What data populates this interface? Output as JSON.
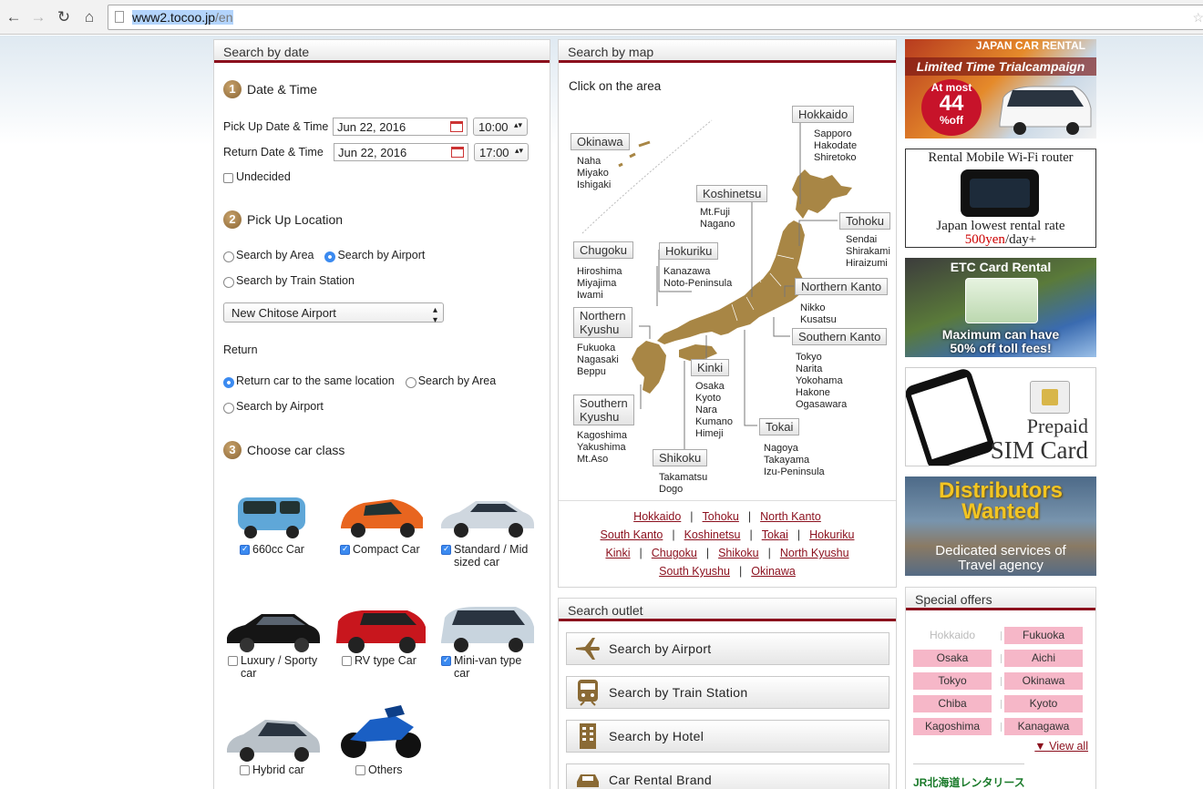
{
  "browser": {
    "url_host": "www2.tocoo.jp",
    "url_path": "/en"
  },
  "search_by_date": {
    "title": "Search by date",
    "step1": {
      "num": "1",
      "label": "Date & Time"
    },
    "pickup_label": "Pick Up Date & Time",
    "pickup_date": "Jun 22, 2016",
    "pickup_time": "10:00",
    "return_label": "Return Date & Time",
    "return_date": "Jun 22, 2016",
    "return_time": "17:00",
    "undecided_label": "Undecided",
    "step2": {
      "num": "2",
      "label": "Pick Up Location"
    },
    "search_area_label": "Search by Area",
    "search_airport_label": "Search by Airport",
    "search_train_label": "Search by Train Station",
    "airport_select": "New Chitose Airport",
    "return_heading": "Return",
    "return_same_label": "Return car to the same location",
    "return_area_label": "Search by Area",
    "return_airport_label": "Search by Airport",
    "step3": {
      "num": "3",
      "label": "Choose car class"
    },
    "car_classes": [
      {
        "label": "660cc Car",
        "checked": true
      },
      {
        "label": "Compact Car",
        "checked": true
      },
      {
        "label": "Standard / Mid sized car",
        "checked": true
      },
      {
        "label": "Luxury / Sporty car",
        "checked": false
      },
      {
        "label": "RV type Car",
        "checked": false
      },
      {
        "label": "Mini-van type car",
        "checked": true
      },
      {
        "label": "Hybrid car",
        "checked": false
      },
      {
        "label": "Others",
        "checked": false
      }
    ]
  },
  "search_by_map": {
    "title": "Search by map",
    "instruction": "Click on the area",
    "regions": {
      "okinawa": {
        "label": "Okinawa",
        "cities": "Naha\nMiyako\nIshigaki"
      },
      "hokkaido": {
        "label": "Hokkaido",
        "cities": "Sapporo\nHakodate\nShiretoko"
      },
      "koshinetsu": {
        "label": "Koshinetsu",
        "cities": "Mt.Fuji\nNagano"
      },
      "tohoku": {
        "label": "Tohoku",
        "cities": "Sendai\nShirakami\nHiraizumi"
      },
      "chugoku": {
        "label": "Chugoku",
        "cities": "Hiroshima\nMiyajima\nIwami"
      },
      "hokuriku": {
        "label": "Hokuriku",
        "cities": "Kanazawa\nNoto-Peninsula"
      },
      "northern_kanto": {
        "label": "Northern Kanto",
        "cities": "Nikko\nKusatsu"
      },
      "northern_kyushu": {
        "label": "Northern\nKyushu",
        "cities": "Fukuoka\nNagasaki\nBeppu"
      },
      "southern_kanto": {
        "label": "Southern Kanto",
        "cities": "Tokyo\nNarita\nYokohama\nHakone\nOgasawara"
      },
      "kinki": {
        "label": "Kinki",
        "cities": "Osaka\nKyoto\nNara\nKumano\nHimeji"
      },
      "southern_kyushu": {
        "label": "Southern\nKyushu",
        "cities": "Kagoshima\nYakushima\nMt.Aso"
      },
      "tokai": {
        "label": "Tokai",
        "cities": "Nagoya\nTakayama\nIzu-Peninsula"
      },
      "shikoku": {
        "label": "Shikoku",
        "cities": "Takamatsu\nDogo"
      }
    },
    "links": [
      [
        "Hokkaido",
        "Tohoku",
        "North Kanto"
      ],
      [
        "South Kanto",
        "Koshinetsu",
        "Tokai",
        "Hokuriku"
      ],
      [
        "Kinki",
        "Chugoku",
        "Shikoku",
        "North Kyushu"
      ],
      [
        "South Kyushu",
        "Okinawa"
      ]
    ],
    "link_separator": "|"
  },
  "search_outlet": {
    "title": "Search outlet",
    "buttons": [
      "Search by Airport",
      "Search by Train Station",
      "Search by Hotel",
      "Car Rental Brand"
    ]
  },
  "ads": {
    "campaign": {
      "line1": "JAPAN CAR RENTAL",
      "line2": "Limited Time Trialcampaign",
      "badge_top": "At most",
      "badge_num": "44",
      "badge_bottom": "%off"
    },
    "wifi": {
      "title": "Rental Mobile Wi-Fi router",
      "line1": "Japan lowest rental rate",
      "price": "500yen",
      "suffix": "/day+"
    },
    "etc": {
      "title": "ETC Card Rental",
      "line1": "Maximum can have",
      "line2": "50% off toll fees!"
    },
    "sim": {
      "line1": "Prepaid",
      "line2": "SIM Card"
    },
    "distributors": {
      "line1": "Distributors",
      "line2": "Wanted",
      "line3": "Dedicated services of",
      "line4": "Travel agency"
    }
  },
  "special_offers": {
    "title": "Special offers",
    "left": [
      "Hokkaido",
      "Osaka",
      "Tokyo",
      "Chiba",
      "Kagoshima"
    ],
    "right": [
      "Fukuoka",
      "Aichi",
      "Okinawa",
      "Kyoto",
      "Kanagawa"
    ],
    "view_all": "▼ View all",
    "logo_text": "JR北海道レンタリース"
  },
  "colors": {
    "accent": "#8b0f1d",
    "map_land": "#a88645",
    "offer_tag": "#f6b7c8"
  }
}
